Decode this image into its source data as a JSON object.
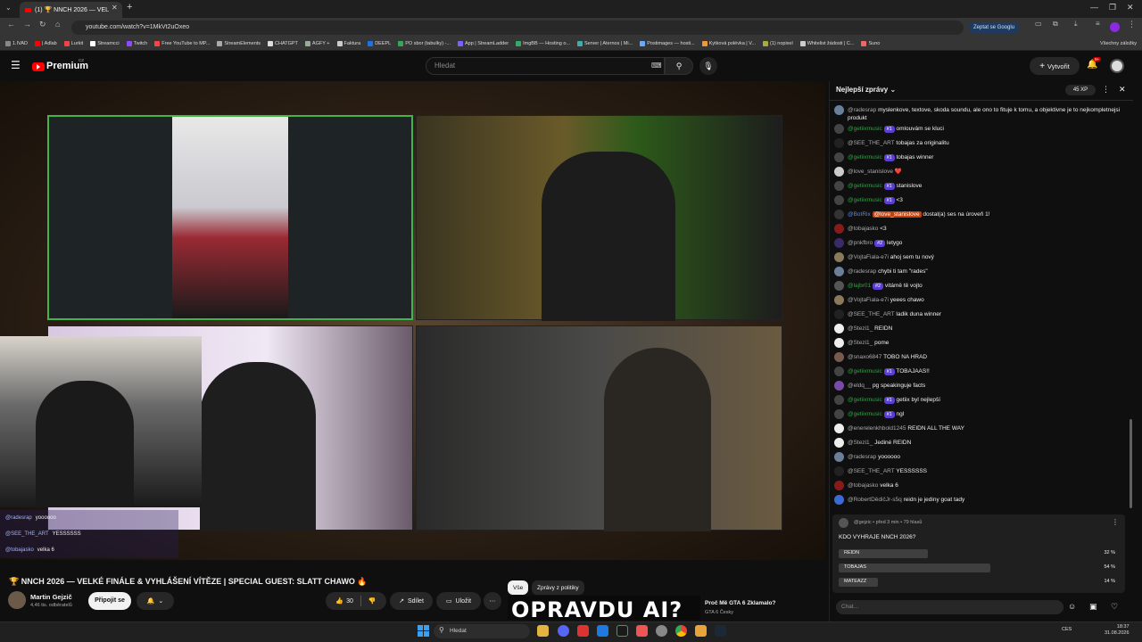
{
  "browser": {
    "tab_title": "(1) 🏆 NNCH 2026 — VEL",
    "url": "youtube.com/watch?v=1MkVt2uOxeo",
    "ask_google": "Zeptat se Googlu",
    "bookmarks": [
      "1.IVAD",
      "| Adlab",
      "Lurkit",
      "Streamcci",
      "Twitch",
      "Free YouTube to MP...",
      "StreamElements",
      "CHATGPT",
      "AGFY +",
      "Faktura",
      "DEEPL",
      "PO sbor (tabulky) -...",
      "App | StreamLadder",
      "ImgBB — Hosting o...",
      "Server | Aternos | Mi...",
      "Postimages — hosti...",
      "Kytková polévka | V...",
      "(1) nopixel",
      "Whitelist žádosti | C...",
      "Suno"
    ],
    "all_bookmarks": "Všechny záložky"
  },
  "youtube": {
    "logo": "Premium",
    "logo_sup": "CZ",
    "search_placeholder": "Hledat",
    "create_label": "Vytvořit",
    "notif_count": "9+"
  },
  "video": {
    "overlay_chat": [
      {
        "user": "@radesrap",
        "text": "yoooooo"
      },
      {
        "user": "@SEE_THE_ART",
        "text": "YESSSSSS"
      },
      {
        "user": "@tobajasko",
        "text": "velka 6"
      }
    ],
    "title": "🏆 NNCH 2026 — VELKÉ FINÁLE & VYHLÁŠENÍ VÍTĚZE | SPECIAL GUEST: SLATT CHAWO 🔥",
    "channel": "Martin Gejzič",
    "subscribers": "4,46 tis. odběratelů",
    "join_label": "Připojit se",
    "likes": "30",
    "share_label": "Sdílet",
    "save_label": "Uložit"
  },
  "recommendations": {
    "chips": [
      "Vše",
      "Zprávy z politiky"
    ],
    "thumb_text": "OPRAVDU AI?",
    "title": "Proč Mě GTA 6 Zklamalo?",
    "channel": "GTA 6 Česky"
  },
  "chat": {
    "header": "Nejlepší zprávy",
    "xp": "45 XP",
    "messages": [
      {
        "user": "@radesrap",
        "badge": "",
        "text": "myslenkove, textove, skoda soundu, ale ono to fituje k tomu, a objektivne je to nejkompletnejsi produkt",
        "color": "gray",
        "avatar": "#6a7f9c"
      },
      {
        "user": "@getiixmusic",
        "badge": "#1",
        "text": "omlouvám se kluci",
        "color": "green",
        "avatar": "#444"
      },
      {
        "user": "@SEE_THE_ART",
        "badge": "",
        "text": "tobajas za originalitu",
        "color": "gray",
        "avatar": "#222"
      },
      {
        "user": "@getiixmusic",
        "badge": "#1",
        "text": "tobajas winner",
        "color": "green",
        "avatar": "#444"
      },
      {
        "user": "@love_stanislove",
        "badge": "",
        "text": "❤️",
        "color": "gray",
        "avatar": "#ccc"
      },
      {
        "user": "@getiixmusic",
        "badge": "#1",
        "text": "stanislove",
        "color": "green",
        "avatar": "#444"
      },
      {
        "user": "@getiixmusic",
        "badge": "#1",
        "text": "<3",
        "color": "green",
        "avatar": "#444"
      },
      {
        "user": "@BotRix",
        "badge": "",
        "text": "dostal(a) ses na úroveň 1!",
        "tag": "@love_stanislove",
        "color": "blue",
        "avatar": "#333"
      },
      {
        "user": "@tobajasko",
        "badge": "",
        "text": "<3",
        "color": "gray",
        "avatar": "#8a1a1a"
      },
      {
        "user": "@pnkfbro",
        "badge": "#2",
        "text": "letygo",
        "color": "gray",
        "avatar": "#3a2a6a"
      },
      {
        "user": "@VojtaFiala-e7i",
        "badge": "",
        "text": "ahoj sem tu nový",
        "color": "gray",
        "avatar": "#8a7a5a"
      },
      {
        "user": "@radesrap",
        "badge": "",
        "text": "chybi ti tam \"rades\"",
        "color": "gray",
        "avatar": "#6a7f9c"
      },
      {
        "user": "@lajbr01",
        "badge": "#2",
        "text": "vitámě tě vojto",
        "color": "green",
        "avatar": "#555"
      },
      {
        "user": "@VojtaFiala-e7i",
        "badge": "",
        "text": "yeees chawo",
        "color": "gray",
        "avatar": "#8a7a5a"
      },
      {
        "user": "@SEE_THE_ART",
        "badge": "",
        "text": "ladik duna winner",
        "color": "gray",
        "avatar": "#222"
      },
      {
        "user": "@Stezi1_",
        "badge": "",
        "text": "REIDN",
        "color": "gray",
        "avatar": "#eee"
      },
      {
        "user": "@Stezi1_",
        "badge": "",
        "text": "pome",
        "color": "gray",
        "avatar": "#eee"
      },
      {
        "user": "@snaxo6847",
        "badge": "",
        "text": "TOBO NA HRAD",
        "color": "gray",
        "avatar": "#7a5a4a"
      },
      {
        "user": "@getiixmusic",
        "badge": "#1",
        "text": "TOBAJAAS!!",
        "color": "green",
        "avatar": "#444"
      },
      {
        "user": "@eldq__",
        "badge": "",
        "text": "pg speakinguje facts",
        "color": "gray",
        "avatar": "#7a4aa8"
      },
      {
        "user": "@getiixmusic",
        "badge": "#1",
        "text": "getiix byl nejlepší",
        "color": "green",
        "avatar": "#444"
      },
      {
        "user": "@getiixmusic",
        "badge": "#1",
        "text": "ngl",
        "color": "green",
        "avatar": "#444"
      },
      {
        "user": "@enerelenkhbold1245",
        "badge": "",
        "text": "REIDN ALL THE WAY",
        "color": "gray",
        "avatar": "#eee"
      },
      {
        "user": "@Stezi1_",
        "badge": "",
        "text": "Jediné REIDN",
        "color": "gray",
        "avatar": "#eee"
      },
      {
        "user": "@radesrap",
        "badge": "",
        "text": "yoooooo",
        "color": "gray",
        "avatar": "#6a7f9c"
      },
      {
        "user": "@SEE_THE_ART",
        "badge": "",
        "text": "YESSSSSS",
        "color": "gray",
        "avatar": "#222"
      },
      {
        "user": "@tobajasko",
        "badge": "",
        "text": "velka 6",
        "color": "gray",
        "avatar": "#8a1a1a"
      },
      {
        "user": "@RobertDědičJr-s5q",
        "badge": "",
        "text": "reidn je jediny goat tady",
        "color": "gray",
        "avatar": "#3a6ad8"
      }
    ],
    "poll": {
      "meta": "@gejzic • před 3 min • 79 hlasů",
      "question": "KDO VYHRAJE NNCH 2026?",
      "options": [
        {
          "label": "REIDN",
          "pct_text": "32 %",
          "pct": 32
        },
        {
          "label": "TOBAJAS",
          "pct_text": "54 %",
          "pct": 54
        },
        {
          "label": "MATEAZZ",
          "pct_text": "14 %",
          "pct": 14
        }
      ]
    },
    "input_placeholder": "Chat..."
  },
  "taskbar": {
    "search": "Hledat",
    "lang": "CES",
    "time": "18:37",
    "date": "31.08.2026"
  }
}
